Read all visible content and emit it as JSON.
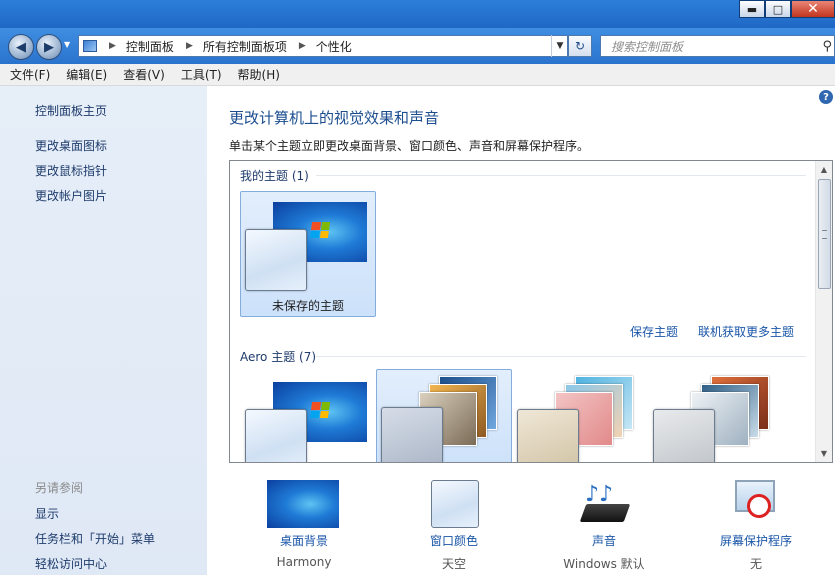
{
  "window": {
    "minimize": "▬",
    "maximize": "□",
    "close": "✕"
  },
  "nav": {
    "back": "◀",
    "forward": "▶",
    "breadcrumb": [
      "控制面板",
      "所有控制面板项",
      "个性化"
    ],
    "search_placeholder": "搜索控制面板",
    "refresh": "↻"
  },
  "menu": [
    "文件(F)",
    "编辑(E)",
    "查看(V)",
    "工具(T)",
    "帮助(H)"
  ],
  "sidebar": {
    "home": "控制面板主页",
    "links": [
      "更改桌面图标",
      "更改鼠标指针",
      "更改帐户图片"
    ],
    "see_also_header": "另请参阅",
    "see_also": [
      "显示",
      "任务栏和「开始」菜单",
      "轻松访问中心"
    ]
  },
  "main": {
    "help": "?",
    "title": "更改计算机上的视觉效果和声音",
    "description": "单击某个主题立即更改桌面背景、窗口颜色、声音和屏幕保护程序。",
    "my_themes_header": "我的主题 (1)",
    "unsaved_theme": "未保存的主题",
    "save_theme": "保存主题",
    "get_more": "联机获取更多主题",
    "aero_header": "Aero 主题 (7)"
  },
  "bottom": [
    {
      "label": "桌面背景",
      "value": "Harmony",
      "icon": "desktop-background-icon"
    },
    {
      "label": "窗口颜色",
      "value": "天空",
      "icon": "window-color-icon"
    },
    {
      "label": "声音",
      "value": "Windows 默认",
      "icon": "sound-icon"
    },
    {
      "label": "屏幕保护程序",
      "value": "无",
      "icon": "screensaver-icon"
    }
  ],
  "colors": {
    "link": "#1a56a8",
    "title": "#1b4d8f",
    "sidebar": "#e3ecf7",
    "titlebar": "#2a73cd"
  }
}
